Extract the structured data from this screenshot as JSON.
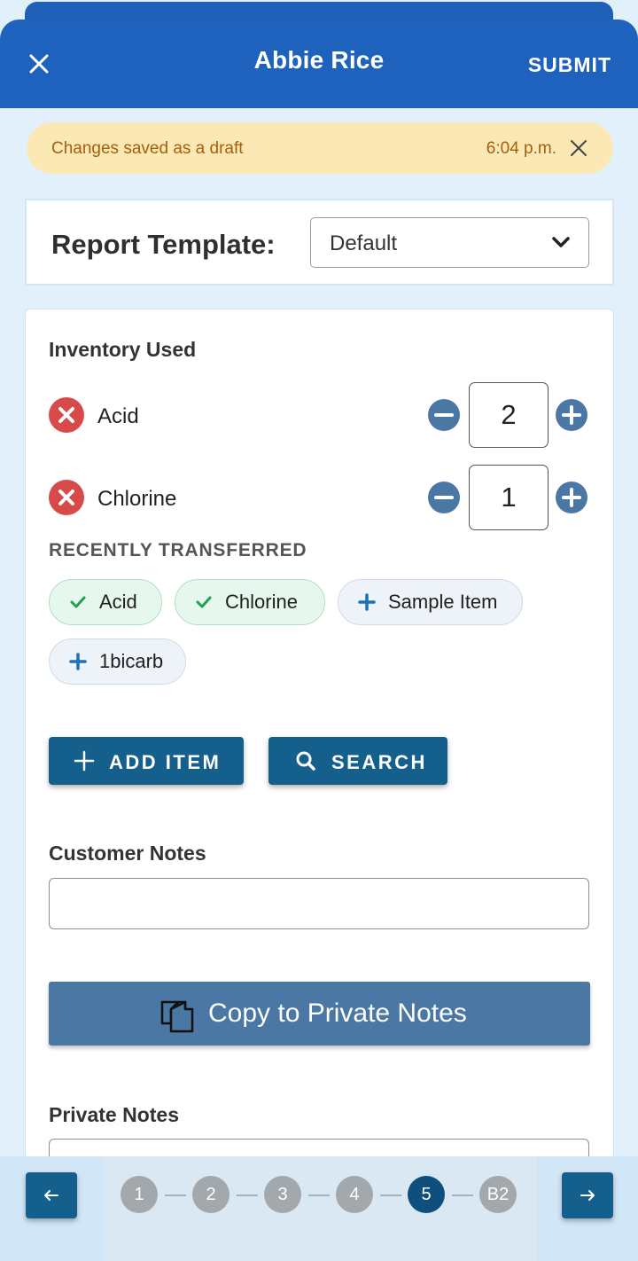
{
  "header": {
    "title": "Abbie Rice",
    "submit_label": "SUBMIT"
  },
  "banner": {
    "message": "Changes saved as a draft",
    "time": "6:04 p.m."
  },
  "report_template": {
    "label": "Report Template:",
    "selected": "Default"
  },
  "inventory": {
    "title": "Inventory Used",
    "items": [
      {
        "name": "Acid",
        "qty": "2"
      },
      {
        "name": "Chlorine",
        "qty": "1"
      }
    ]
  },
  "recently_transferred": {
    "title": "RECENTLY TRANSFERRED",
    "chips": [
      {
        "label": "Acid",
        "state": "added"
      },
      {
        "label": "Chlorine",
        "state": "added"
      },
      {
        "label": "Sample Item",
        "state": "available"
      },
      {
        "label": "1bicarb",
        "state": "available"
      }
    ]
  },
  "actions": {
    "add_item_label": "ADD ITEM",
    "search_label": "SEARCH"
  },
  "customer_notes": {
    "label": "Customer Notes",
    "value": ""
  },
  "copy_button": {
    "label": "Copy to Private Notes"
  },
  "private_notes": {
    "label": "Private Notes",
    "value": ""
  },
  "stepper": {
    "steps": [
      "1",
      "2",
      "3",
      "4",
      "5",
      "B2"
    ],
    "active_step": "5"
  },
  "colors": {
    "header": "#1f62bd",
    "banner_bg": "#fbe8b5",
    "banner_text": "#a45f0a",
    "primary_button": "#155f8c",
    "remove_icon": "#d84a4a",
    "stepper_icon": "#4a77a3",
    "chip_check": "#22a04b"
  }
}
